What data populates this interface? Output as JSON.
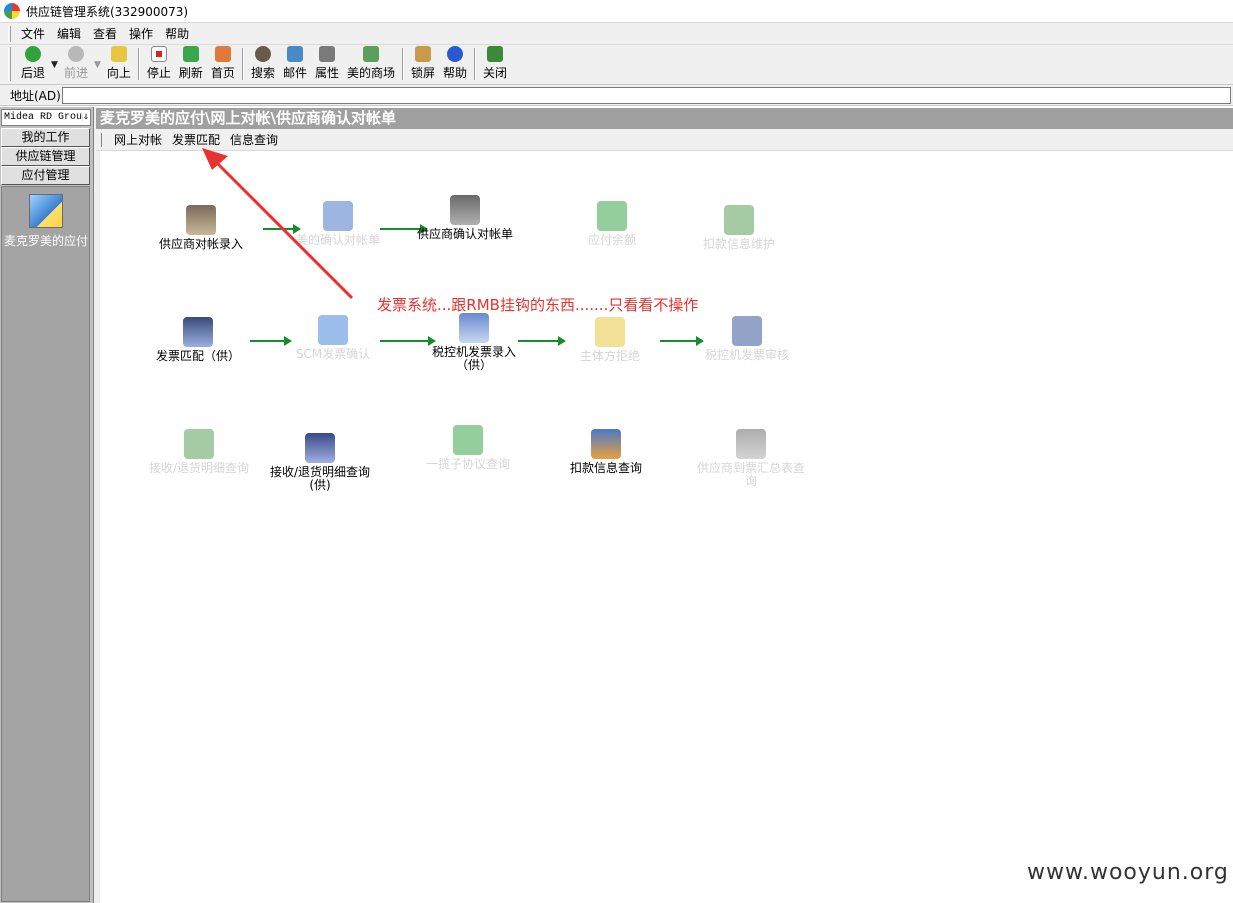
{
  "window": {
    "title": "供应链管理系统(332900073)"
  },
  "menu": [
    "文件",
    "编辑",
    "查看",
    "操作",
    "帮助"
  ],
  "toolbar": {
    "back": "后退",
    "forward": "前进",
    "up": "向上",
    "stop": "停止",
    "refresh": "刷新",
    "home": "首页",
    "search": "搜索",
    "mail": "邮件",
    "properties": "属性",
    "mall": "美的商场",
    "lock": "锁屏",
    "help": "帮助",
    "close": "关闭"
  },
  "address": {
    "label": "地址(AD)",
    "value": ""
  },
  "left": {
    "combo": "Midea RD Group",
    "buttons": [
      "我的工作",
      "供应链管理",
      "应付管理"
    ],
    "app_label": "麦克罗美的应付"
  },
  "main": {
    "header": "麦克罗美的应付\\网上对帐\\供应商确认对帐单",
    "tabs": [
      "网上对帐",
      "发票匹配",
      "信息查询"
    ],
    "row1": [
      {
        "label": "供应商对帐录入",
        "enabled": true
      },
      {
        "label": "美的确认对帐单",
        "enabled": false
      },
      {
        "label": "供应商确认对帐单",
        "enabled": true
      },
      {
        "label": "应付余额",
        "enabled": false
      },
      {
        "label": "扣款信息维护",
        "enabled": false
      }
    ],
    "row2": [
      {
        "label": "发票匹配（供）",
        "enabled": true
      },
      {
        "label": "SCM发票确认",
        "enabled": false
      },
      {
        "label": "税控机发票录入（供）",
        "enabled": true
      },
      {
        "label": "主体方拒绝",
        "enabled": false
      },
      {
        "label": "税控机发票审核",
        "enabled": false
      }
    ],
    "row3": [
      {
        "label": "接收/退货明细查询",
        "enabled": false
      },
      {
        "label": "接收/退货明细查询(供)",
        "enabled": true
      },
      {
        "label": "一揽子协议查询",
        "enabled": false
      },
      {
        "label": "扣款信息查询",
        "enabled": true
      },
      {
        "label": "供应商到票汇总表查询",
        "enabled": false
      }
    ]
  },
  "annotation": "发票系统...跟RMB挂钩的东西.......只看看不操作",
  "watermark": "www.wooyun.org",
  "colors": {
    "arrow_green": "#1a8a2e",
    "annotation_red": "#e8322f",
    "header_gray": "#a0a0a0"
  }
}
